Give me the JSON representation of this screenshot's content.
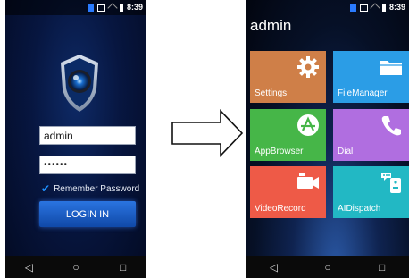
{
  "login_screen": {
    "status_time": "8:39",
    "username_value": "admin",
    "password_value": "••••••",
    "remember_label": "Remember Password",
    "remember_checked": true,
    "login_button": "LOGIN IN"
  },
  "home_screen": {
    "status_time": "8:39",
    "user_title": "admin",
    "tiles": [
      {
        "label": "Settings",
        "icon": "gear-icon",
        "color": "#cf7f48"
      },
      {
        "label": "FileManager",
        "icon": "folder-icon",
        "color": "#2b9de6"
      },
      {
        "label": "AppBrowser",
        "icon": "browser-icon",
        "color": "#46b648"
      },
      {
        "label": "Dial",
        "icon": "phone-icon",
        "color": "#b06ee0"
      },
      {
        "label": "VideoRecord",
        "icon": "video-camera-icon",
        "color": "#ee5a47"
      },
      {
        "label": "AIDispatch",
        "icon": "robot-icon",
        "color": "#22b8c4"
      }
    ]
  },
  "navbar": {
    "back": "◁",
    "home": "○",
    "recents": "□"
  }
}
